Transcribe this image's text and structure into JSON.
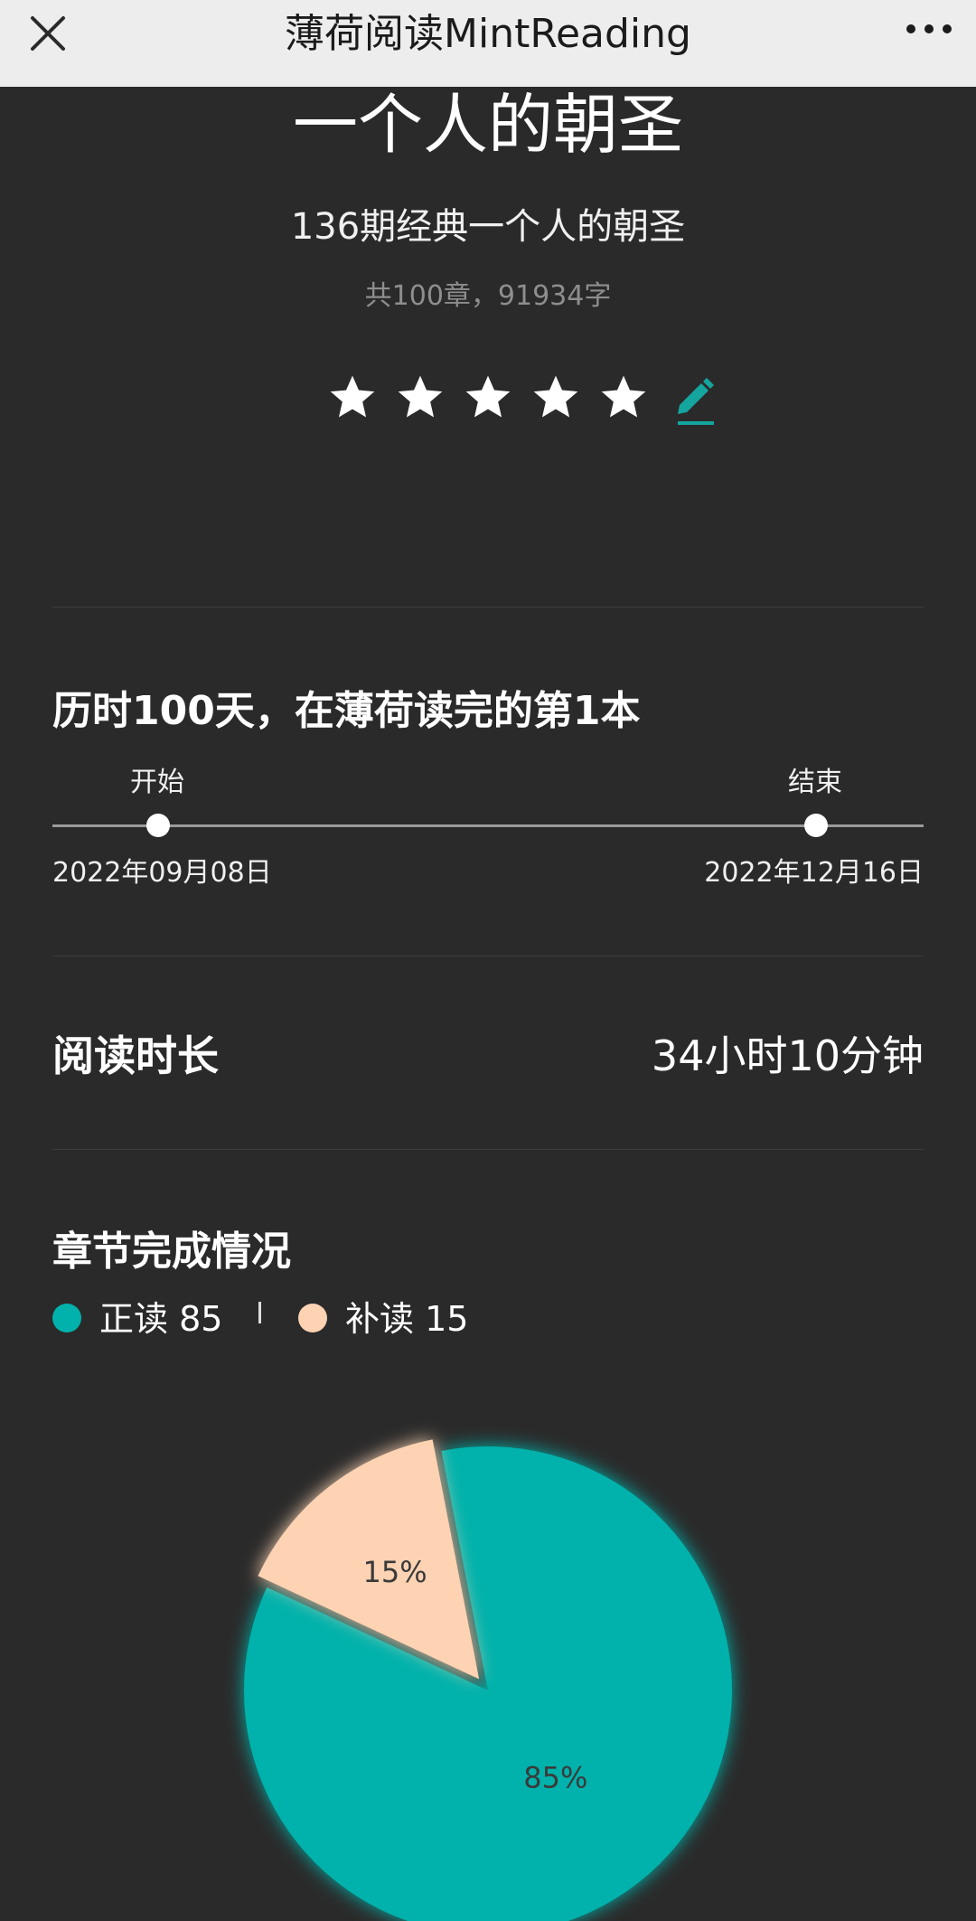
{
  "topbar": {
    "title": "薄荷阅读MintReading",
    "close_icon": "close-icon",
    "more_icon": "more-horizontal-icon"
  },
  "book": {
    "title": "一个人的朝圣",
    "subtitle": "136期经典一个人的朝圣",
    "meta": "共100章，91934字",
    "rating": 5,
    "rating_max": 5,
    "edit_icon": "pencil-icon"
  },
  "timeline": {
    "title": "历时100天，在薄荷读完的第1本",
    "start_label": "开始",
    "end_label": "结束",
    "start_date": "2022年09月08日",
    "end_date": "2022年12月16日"
  },
  "duration": {
    "label": "阅读时长",
    "value": "34小时10分钟"
  },
  "chapters": {
    "title": "章节完成情况",
    "legend": [
      {
        "label": "正读 85",
        "color": "#00b2ab"
      },
      {
        "label": "补读 15",
        "color": "#fdd3b3"
      }
    ]
  },
  "chart_data": {
    "type": "pie",
    "categories": [
      "正读",
      "补读"
    ],
    "values": [
      85,
      15
    ],
    "labels": [
      "85%",
      "15%"
    ],
    "colors": [
      "#00b2ab",
      "#fdd3b3"
    ],
    "offset_slice": 1
  }
}
